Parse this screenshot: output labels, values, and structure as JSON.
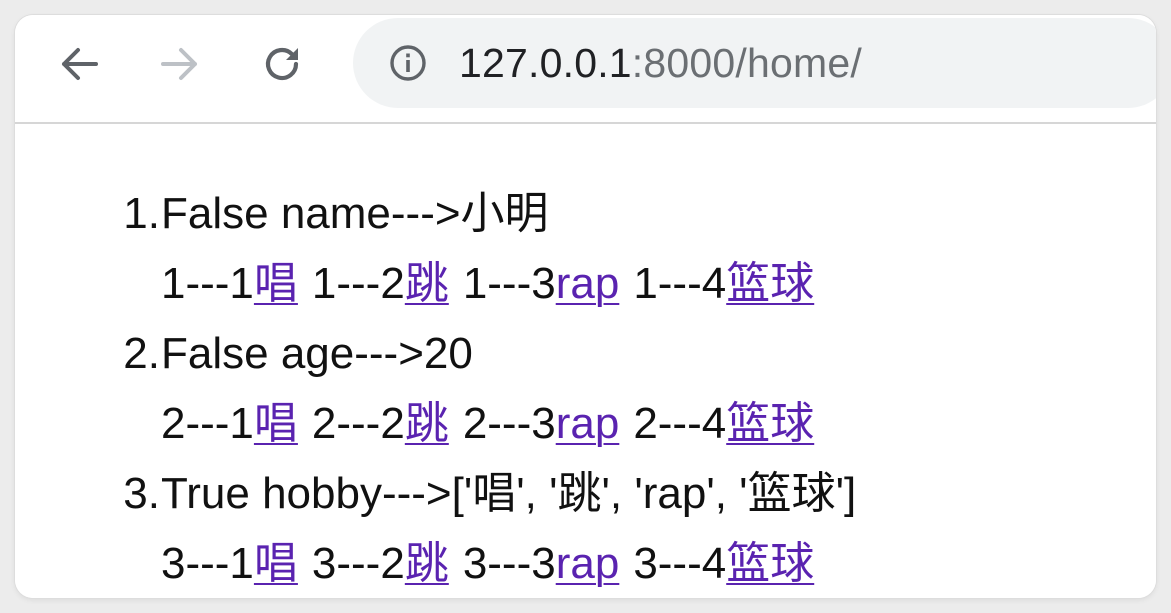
{
  "browser": {
    "url_host": "127.0.0.1",
    "url_rest": ":8000/home/",
    "icons": {
      "back": "arrow-left-icon",
      "forward": "arrow-right-icon",
      "reload": "reload-icon",
      "info": "info-circle-icon"
    },
    "colors": {
      "icon_active": "#5f6368",
      "icon_disabled": "#bdc1c6",
      "link": "#5a23b0"
    }
  },
  "items": [
    {
      "marker": "1.",
      "header": "False name--->小明",
      "entries": [
        {
          "prefix": "1---1",
          "link": "唱"
        },
        {
          "prefix": "1---2",
          "link": "跳"
        },
        {
          "prefix": "1---3",
          "link": "rap"
        },
        {
          "prefix": "1---4",
          "link": "篮球"
        }
      ]
    },
    {
      "marker": "2.",
      "header": "False age--->20",
      "entries": [
        {
          "prefix": "2---1",
          "link": "唱"
        },
        {
          "prefix": "2---2",
          "link": "跳"
        },
        {
          "prefix": "2---3",
          "link": "rap"
        },
        {
          "prefix": "2---4",
          "link": "篮球"
        }
      ]
    },
    {
      "marker": "3.",
      "header": "True hobby--->['唱', '跳', 'rap', '篮球']",
      "entries": [
        {
          "prefix": "3---1",
          "link": "唱"
        },
        {
          "prefix": "3---2",
          "link": "跳"
        },
        {
          "prefix": "3---3",
          "link": "rap"
        },
        {
          "prefix": "3---4",
          "link": "篮球"
        }
      ]
    }
  ]
}
